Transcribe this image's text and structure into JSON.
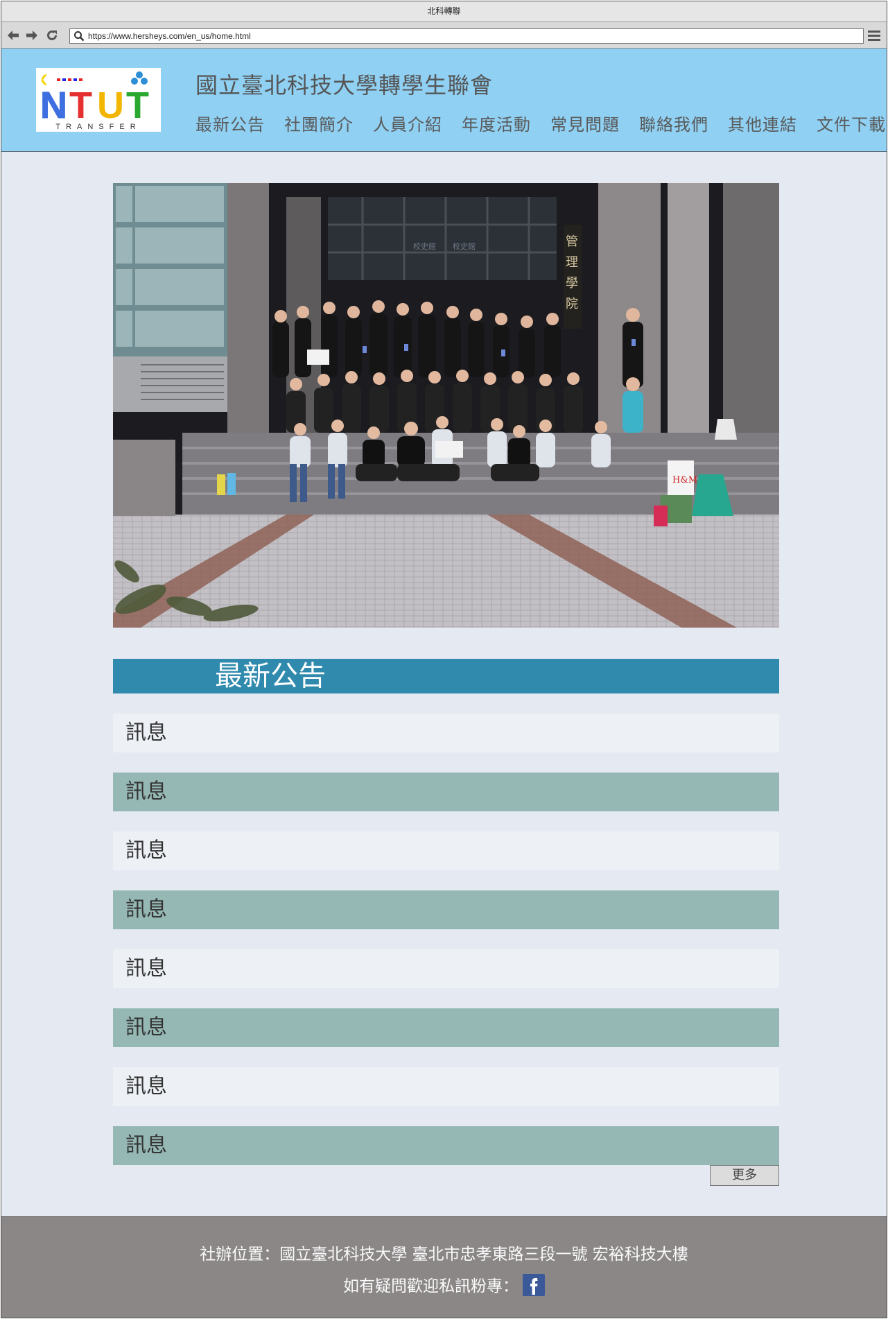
{
  "browser": {
    "title": "北科轉聯",
    "url": "https://www.hersheys.com/en_us/home.html"
  },
  "header": {
    "logo_text": "NTUT",
    "logo_subtext": "TRANSFER",
    "title": "國立臺北科技大學轉學生聯會",
    "nav": [
      "最新公告",
      "社團簡介",
      "人員介紹",
      "年度活動",
      "常見問題",
      "聯絡我們",
      "其他連結",
      "文件下載"
    ]
  },
  "hero": {
    "sign_1": "校史館",
    "sign_2": "校史館",
    "sign_vertical": "管理學院",
    "bag_logo": "H&M"
  },
  "announcements": {
    "heading": "最新公告",
    "items": [
      "訊息",
      "訊息",
      "訊息",
      "訊息",
      "訊息",
      "訊息",
      "訊息",
      "訊息"
    ],
    "more_label": "更多"
  },
  "footer": {
    "address": "社辦位置：國立臺北科技大學  臺北市忠孝東路三段一號  宏裕科技大樓",
    "contact": "如有疑問歡迎私訊粉專："
  },
  "colors": {
    "header_bg": "#8fd0f3",
    "section_head": "#2f8aad",
    "row_dark": "#95b8b5",
    "row_light": "#edf1f6",
    "footer_bg": "#8a8786",
    "page_bg": "#e4e9f2"
  }
}
